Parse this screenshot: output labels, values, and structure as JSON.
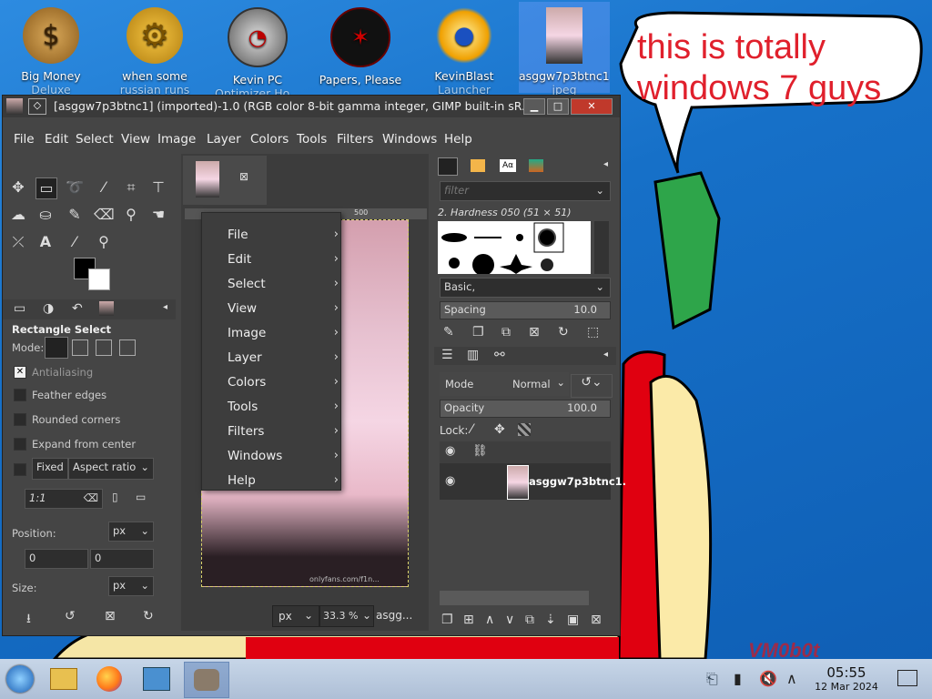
{
  "desktop": {
    "icons": [
      {
        "label": "Big Money",
        "label2": "Deluxe",
        "icon": "money-bag-icon"
      },
      {
        "label": "when some",
        "label2": "russian runs a...",
        "icon": "gear-icon"
      },
      {
        "label": "Kevin PC",
        "label2": "Optimizer Ho...",
        "icon": "speedometer-icon"
      },
      {
        "label": "Papers, Please",
        "label2": "",
        "icon": "papers-please-icon"
      },
      {
        "label": "KevinBlast",
        "label2": "Launcher",
        "icon": "starburst-icon"
      },
      {
        "label": "asggw7p3btnc1.",
        "label2": "jpeg",
        "icon": "image-thumbnail-icon"
      }
    ],
    "bubble_text": "this is totally windows 7 guys",
    "signature": "VM0b0t"
  },
  "window": {
    "title": "[asggw7p3btnc1] (imported)-1.0 (RGB color 8-bit gamma integer, GIMP built-in sR...",
    "menu": [
      "File",
      "Edit",
      "Select",
      "View",
      "Image",
      "Layer",
      "Colors",
      "Tools",
      "Filters",
      "Windows",
      "Help"
    ],
    "controls": {
      "minimize": "▁",
      "maximize": "□",
      "close": "✕"
    }
  },
  "toolbox": {
    "tool_options_title": "Rectangle Select",
    "mode_label": "Mode:",
    "antialiasing": "Antialiasing",
    "feather": "Feather edges",
    "rounded": "Rounded corners",
    "expand": "Expand from center",
    "fixed": "Fixed",
    "fixed_option": "Aspect ratio",
    "ratio_value": "1:1",
    "position_label": "Position:",
    "position_unit": "px",
    "pos_x": "0",
    "pos_y": "0",
    "size_label": "Size:",
    "size_unit": "px"
  },
  "canvas": {
    "ruler_mark": "500",
    "unit": "px",
    "zoom": "33.3 %",
    "filename_short": "asgg...",
    "watermark": "onlyfans.com/f1n..."
  },
  "context_menu": [
    "File",
    "Edit",
    "Select",
    "View",
    "Image",
    "Layer",
    "Colors",
    "Tools",
    "Filters",
    "Windows",
    "Help"
  ],
  "brushes": {
    "filter_placeholder": "filter",
    "current": "2. Hardness 050 (51 × 51)",
    "set": "Basic,",
    "spacing_label": "Spacing",
    "spacing_value": "10.0"
  },
  "layers": {
    "mode_label": "Mode",
    "mode_value": "Normal",
    "opacity_label": "Opacity",
    "opacity_value": "100.0",
    "lock_label": "Lock:",
    "layer_name": "asggw7p3btnc1."
  },
  "taskbar": {
    "time": "05:55",
    "date": "12 Mar 2024"
  }
}
